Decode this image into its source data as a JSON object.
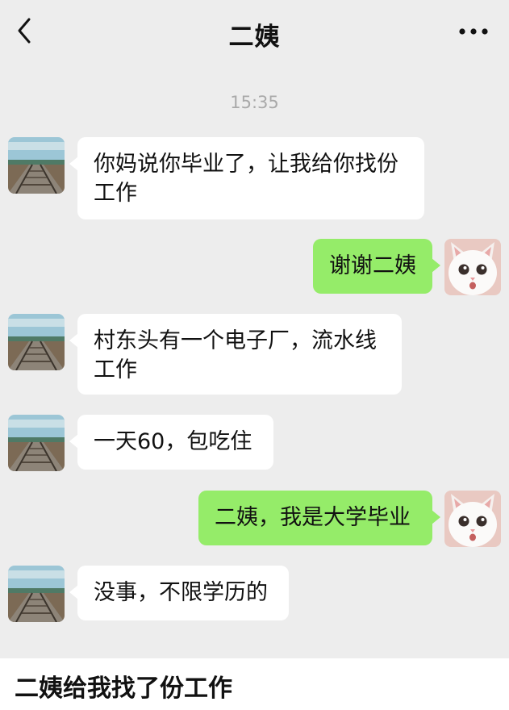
{
  "header": {
    "title": "二姨",
    "back_icon": "chevron-left-icon",
    "more_icon": "ellipsis-icon"
  },
  "chat": {
    "timestamp": "15:35",
    "messages": [
      {
        "from": "aunt",
        "text": "你妈说你毕业了，让我给你找份工作"
      },
      {
        "from": "me",
        "text": "谢谢二姨"
      },
      {
        "from": "aunt",
        "text": "村东头有一个电子厂，流水线工作"
      },
      {
        "from": "aunt",
        "text": "一天60，包吃住"
      },
      {
        "from": "me",
        "text": "二姨，我是大学毕业"
      },
      {
        "from": "aunt",
        "text": "没事，不限学历的"
      }
    ]
  },
  "caption": "二姨给我找了份工作",
  "colors": {
    "background": "#ededed",
    "incoming_bubble": "#ffffff",
    "outgoing_bubble": "#95ec69",
    "timestamp": "#a9a9a9"
  }
}
